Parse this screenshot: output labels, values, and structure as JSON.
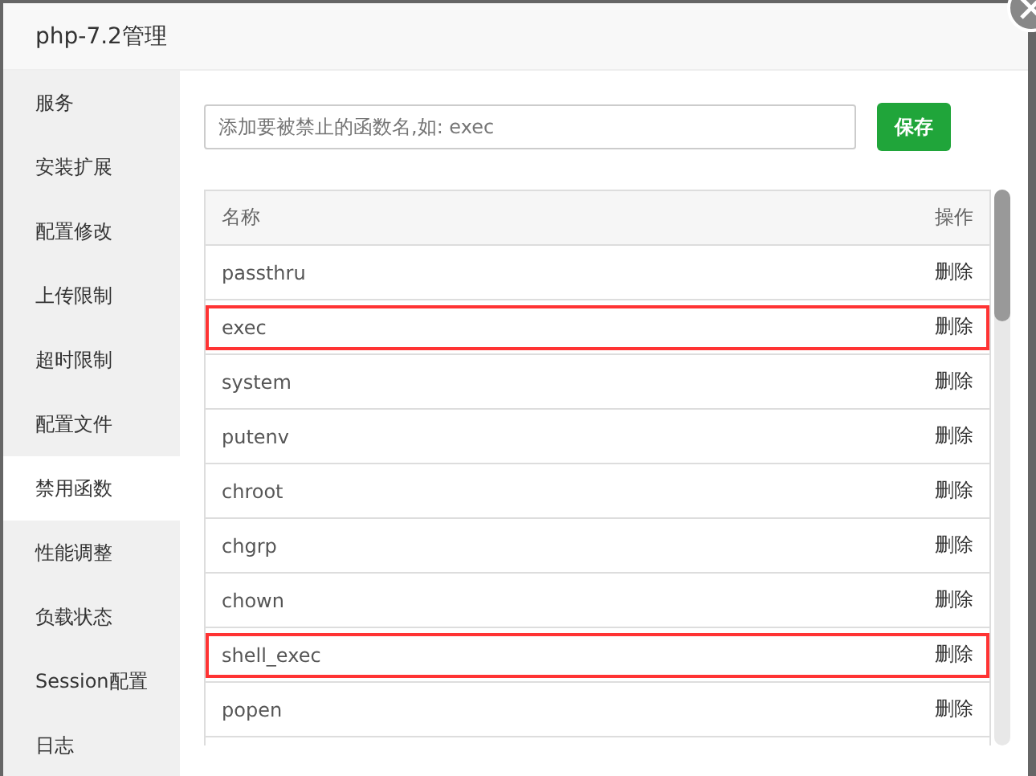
{
  "window": {
    "title": "php-7.2管理"
  },
  "sidebar": {
    "items": [
      {
        "label": "服务",
        "selected": false
      },
      {
        "label": "安装扩展",
        "selected": false
      },
      {
        "label": "配置修改",
        "selected": false
      },
      {
        "label": "上传限制",
        "selected": false
      },
      {
        "label": "超时限制",
        "selected": false
      },
      {
        "label": "配置文件",
        "selected": false
      },
      {
        "label": "禁用函数",
        "selected": true
      },
      {
        "label": "性能调整",
        "selected": false
      },
      {
        "label": "负载状态",
        "selected": false
      },
      {
        "label": "Session配置",
        "selected": false
      },
      {
        "label": "日志",
        "selected": false
      }
    ]
  },
  "form": {
    "placeholder": "添加要被禁止的函数名,如: exec",
    "button": "保存"
  },
  "table": {
    "columns": [
      "名称",
      "操作"
    ],
    "rows": [
      {
        "name": "passthru",
        "action": "删除",
        "highlighted": false
      },
      {
        "name": "exec",
        "action": "删除",
        "highlighted": true
      },
      {
        "name": "system",
        "action": "删除",
        "highlighted": false
      },
      {
        "name": "putenv",
        "action": "删除",
        "highlighted": false
      },
      {
        "name": "chroot",
        "action": "删除",
        "highlighted": false
      },
      {
        "name": "chgrp",
        "action": "删除",
        "highlighted": false
      },
      {
        "name": "chown",
        "action": "删除",
        "highlighted": false
      },
      {
        "name": "shell_exec",
        "action": "删除",
        "highlighted": true
      },
      {
        "name": "popen",
        "action": "删除",
        "highlighted": false
      }
    ]
  }
}
